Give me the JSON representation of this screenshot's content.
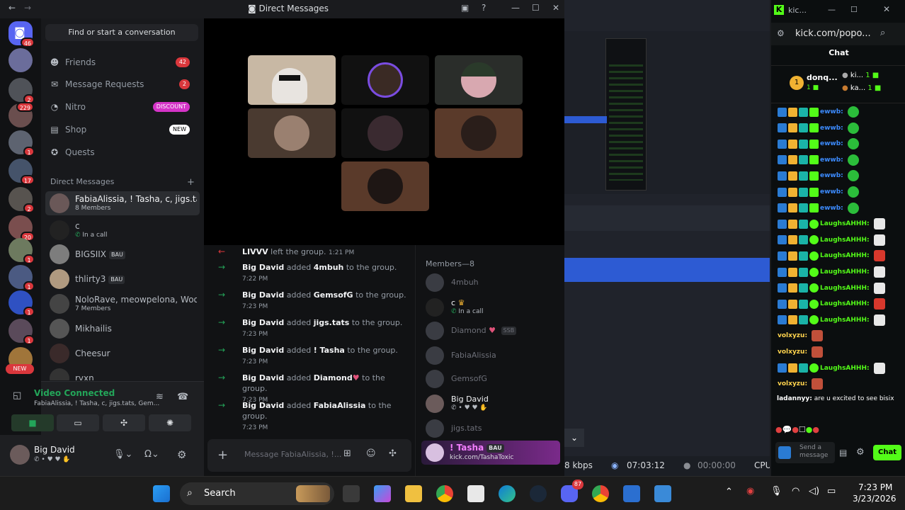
{
  "discord": {
    "window_title": "Direct Messages",
    "search_placeholder": "Find or start a conversation",
    "nav": [
      {
        "label": "Friends",
        "badge": "42",
        "icon": "friends-icon"
      },
      {
        "label": "Message Requests",
        "badge": "2",
        "icon": "mail-icon"
      },
      {
        "label": "Nitro",
        "badge": "DISCOUNT",
        "icon": "nitro-icon"
      },
      {
        "label": "Shop",
        "badge": "NEW",
        "icon": "shop-icon"
      },
      {
        "label": "Quests",
        "badge": "",
        "icon": "quests-icon"
      }
    ],
    "dm_header": "Direct Messages",
    "guild_badges": [
      "46",
      "",
      "2",
      "229",
      "1",
      "17",
      "2",
      "20",
      "1",
      "1",
      "1",
      "1",
      "NEW"
    ],
    "dms": [
      {
        "name": "FabiaAlissia, ! Tasha, c, jigs.ta...",
        "sub": "8 Members",
        "tag": ""
      },
      {
        "name": "c",
        "sub": "In a call",
        "tag": ""
      },
      {
        "name": "BIGSIIX",
        "sub": "",
        "tag": "BAU"
      },
      {
        "name": "thlirty3",
        "sub": "",
        "tag": "BAU"
      },
      {
        "name": "NoloRave, meowpelona, Woo...",
        "sub": "7 Members",
        "tag": ""
      },
      {
        "name": "Mikhailis",
        "sub": "",
        "tag": ""
      },
      {
        "name": "Cheesur",
        "sub": "",
        "tag": ""
      },
      {
        "name": "ryxn",
        "sub": "",
        "tag": ""
      }
    ],
    "voice": {
      "status": "Video Connected",
      "channel": "FabiaAlissia, ! Tasha, c, jigs.tats, Gem..."
    },
    "user": {
      "name": "Big David"
    },
    "chat": {
      "messages": [
        {
          "actor": "LIVVV",
          "action": "left the group.",
          "target": "",
          "suffix": "",
          "time": "1:21 PM",
          "kind": "leave"
        },
        {
          "actor": "Big David",
          "action": "added",
          "target": "4mbuh",
          "suffix": "to the group.",
          "time": "7:22 PM",
          "kind": "add"
        },
        {
          "actor": "Big David",
          "action": "added",
          "target": "GemsofG",
          "suffix": "to the group.",
          "time": "7:23 PM",
          "kind": "add"
        },
        {
          "actor": "Big David",
          "action": "added",
          "target": "jigs.tats",
          "suffix": "to the group.",
          "time": "7:23 PM",
          "kind": "add"
        },
        {
          "actor": "Big David",
          "action": "added",
          "target": "! Tasha",
          "suffix": "to the group.",
          "time": "7:23 PM",
          "kind": "add"
        },
        {
          "actor": "Big David",
          "action": "added",
          "target": "Diamond",
          "suffix": "to the group.",
          "time": "7:23 PM",
          "kind": "add"
        },
        {
          "actor": "Big David",
          "action": "added",
          "target": "FabiaAlissia",
          "suffix": "to the group.",
          "time": "7:23 PM",
          "kind": "add"
        }
      ],
      "composer_placeholder": "Message FabiaAlissia, !..."
    },
    "members": {
      "header": "Members—8",
      "list": [
        {
          "name": "4mbuh",
          "sub": ""
        },
        {
          "name": "c",
          "sub": "In a call"
        },
        {
          "name": "Diamond",
          "sub": "SSB"
        },
        {
          "name": "FabiaAlissia",
          "sub": ""
        },
        {
          "name": "GemsofG",
          "sub": ""
        },
        {
          "name": "Big David",
          "sub": ""
        },
        {
          "name": "jigs.tats",
          "sub": ""
        },
        {
          "name": "! Tasha",
          "sub": "kick.com/TashaToxic",
          "tag": "BAU"
        }
      ]
    }
  },
  "obs": {
    "bitrate": "8 kbps",
    "live_time": "07:03:12",
    "rec_time": "00:00:00",
    "cpu": "CPU"
  },
  "kick": {
    "tab_title": "kic...",
    "url": "kick.com/popo...",
    "chat_title": "Chat",
    "top_gifter": "donq...",
    "gifters": [
      "ki...",
      "ka..."
    ],
    "chat_lines": [
      {
        "user": "ewwb:",
        "color": "#3c8bff"
      },
      {
        "user": "ewwb:",
        "color": "#3c8bff"
      },
      {
        "user": "ewwb:",
        "color": "#3c8bff"
      },
      {
        "user": "ewwb:",
        "color": "#3c8bff"
      },
      {
        "user": "ewwb:",
        "color": "#3c8bff"
      },
      {
        "user": "ewwb:",
        "color": "#3c8bff"
      },
      {
        "user": "ewwb:",
        "color": "#3c8bff"
      },
      {
        "user": "LaughsAHHH:",
        "color": "#53fc18"
      },
      {
        "user": "LaughsAHHH:",
        "color": "#53fc18"
      },
      {
        "user": "LaughsAHHH:",
        "color": "#53fc18"
      },
      {
        "user": "LaughsAHHH:",
        "color": "#53fc18"
      },
      {
        "user": "LaughsAHHH:",
        "color": "#53fc18"
      },
      {
        "user": "LaughsAHHH:",
        "color": "#53fc18"
      },
      {
        "user": "LaughsAHHH:",
        "color": "#53fc18"
      },
      {
        "user": "volxyzu:",
        "color": "#ffd34d"
      },
      {
        "user": "volxyzu:",
        "color": "#ffd34d"
      },
      {
        "user": "LaughsAHHH:",
        "color": "#53fc18"
      },
      {
        "user": "volxyzu:",
        "color": "#ffd34d"
      }
    ],
    "last_msg_user": "ladannyy:",
    "last_msg_text": "are u excited to see bisix",
    "send_placeholder": "Send a message",
    "chat_button": "Chat",
    "accent": "#53fc18"
  },
  "taskbar": {
    "search": "Search",
    "time": "7:23 PM",
    "date": "3/23/2026",
    "discord_badge": "87"
  },
  "colors": {
    "discord_red": "#da373c",
    "discord_green": "#23a559",
    "nitro_pink": "#d534c8"
  }
}
